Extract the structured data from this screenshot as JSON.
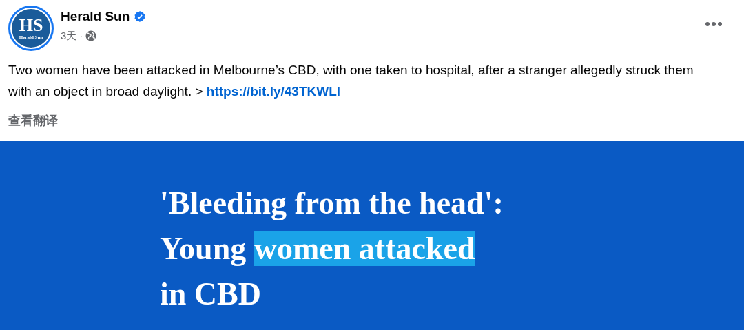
{
  "post": {
    "avatar": {
      "initials": "HS",
      "caption": "Herald Sun"
    },
    "author": "Herald Sun",
    "verified": true,
    "time": "3天",
    "separator": "·",
    "text": "Two women have been attacked in Melbourne’s CBD, with one taken to hospital, after a stranger allegedly struck them with an object in broad daylight. >",
    "link": "https://bit.ly/43TKWLl",
    "translate": "查看翻译"
  },
  "card": {
    "lines": [
      [
        {
          "text": "'Bleeding from the head':",
          "highlighted": false
        }
      ],
      [
        {
          "text": "Young ",
          "highlighted": false
        },
        {
          "text": "women attacked",
          "highlighted": true
        }
      ],
      [
        {
          "text": "in CBD",
          "highlighted": false
        }
      ]
    ]
  }
}
